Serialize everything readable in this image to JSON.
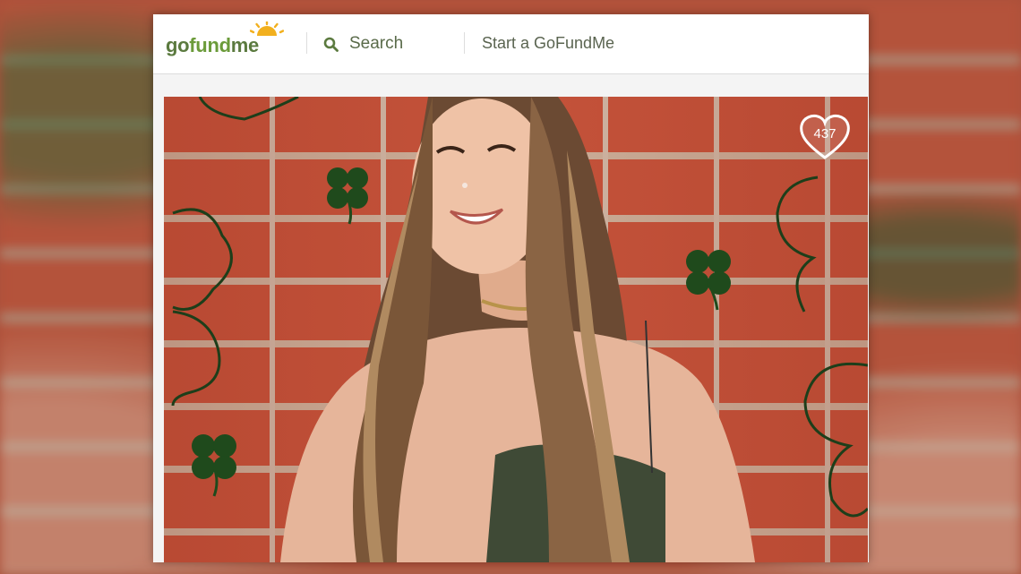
{
  "header": {
    "logo": {
      "go": "go",
      "fund": "fund",
      "me": "me"
    },
    "search_label": "Search",
    "start_label": "Start a GoFundMe"
  },
  "campaign_photo": {
    "like_count": "437"
  },
  "colors": {
    "brand_green": "#6b9b3a",
    "brand_dark_green": "#5b7a3f",
    "brick": "#c4533a",
    "clover": "#1f4a1c"
  },
  "icons": [
    "sun-logo-icon",
    "search-icon",
    "heart-icon",
    "clover-icon"
  ]
}
